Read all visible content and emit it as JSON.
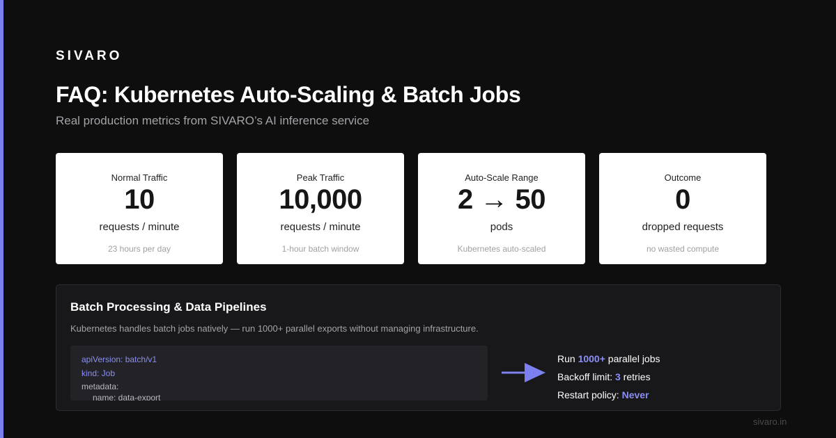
{
  "brand": "SIVARO",
  "title": "FAQ: Kubernetes Auto-Scaling & Batch Jobs",
  "subtitle": "Real production metrics from SIVARO’s AI inference service",
  "accent_color": "#7b7ff0",
  "cards": [
    {
      "label": "Normal Traffic",
      "value": "10",
      "unit": "requests / minute",
      "note": "23 hours per day"
    },
    {
      "label": "Peak Traffic",
      "value": "10,000",
      "unit": "requests / minute",
      "note": "1-hour batch window"
    },
    {
      "label": "Auto-Scale Range",
      "value": "2 → 50",
      "unit": "pods",
      "note": "Kubernetes auto-scaled"
    },
    {
      "label": "Outcome",
      "value": "0",
      "unit": "dropped requests",
      "note": "no wasted compute"
    }
  ],
  "panel": {
    "title": "Batch Processing & Data Pipelines",
    "description": "Kubernetes handles batch jobs natively — run 1000+ parallel exports without managing infrastructure.",
    "code_lines": [
      "apiVersion: batch/v1",
      "kind: Job",
      "metadata:",
      "name: data-export"
    ],
    "arrow_icon": "arrow-right-icon",
    "facts": [
      {
        "prefix": "Run ",
        "highlight": "1000+",
        "suffix": " parallel jobs"
      },
      {
        "prefix": "Backoff limit: ",
        "highlight": "3",
        "suffix": " retries"
      },
      {
        "prefix": "Restart policy: ",
        "highlight": "Never",
        "suffix": ""
      }
    ]
  },
  "footer": "sivaro.in"
}
